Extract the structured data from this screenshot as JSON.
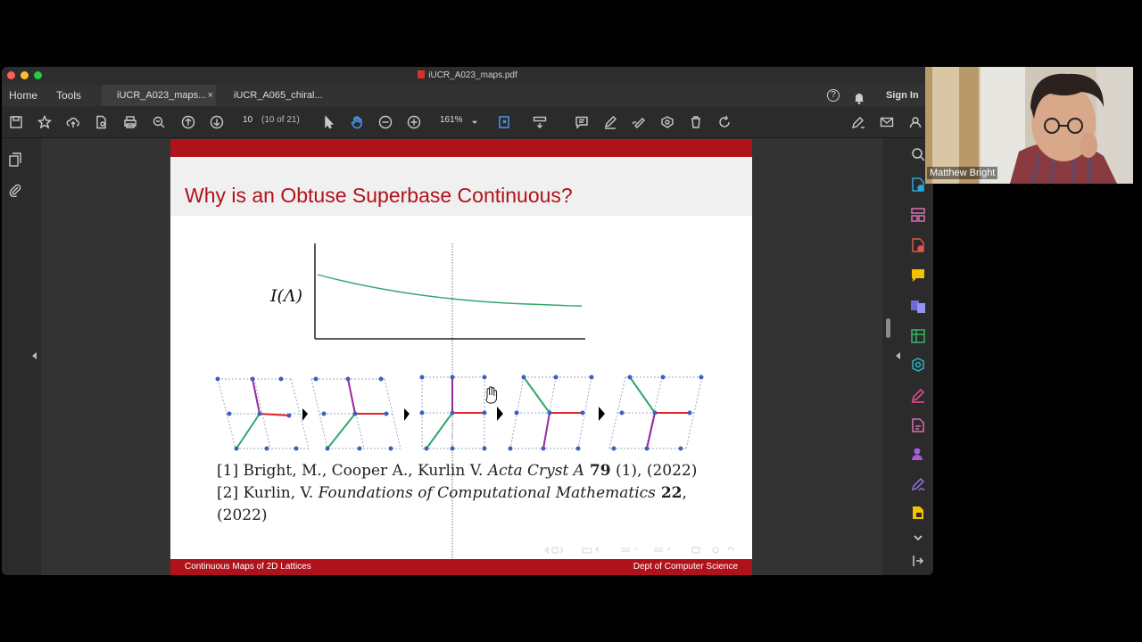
{
  "window": {
    "title": "iUCR_A023_maps.pdf"
  },
  "tabs": {
    "home": "Home",
    "tools": "Tools",
    "tab1": "iUCR_A023_maps...",
    "tab2": "iUCR_A065_chiral...",
    "sign_in": "Sign In",
    "close": "×"
  },
  "toolbar": {
    "page": "10",
    "page_of": "(10 of 21)",
    "zoom": "161%"
  },
  "slide": {
    "title": "Why is an Obtuse Superbase Continuous?",
    "ylabel": "I(Λ)",
    "ref1_pre": "[1] Bright, M., Cooper A., Kurlin V. ",
    "ref1_journal": "Acta Cryst A",
    "ref1_vol": " 79",
    "ref1_post": " (1), (2022)",
    "ref2_pre": "[2] Kurlin, V. ",
    "ref2_journal": "Foundations of Computational Mathematics",
    "ref2_vol": " 22",
    "ref2_post": ",",
    "ref2_line2": "(2022)",
    "footer_left": "Continuous Maps of 2D Lattices",
    "footer_right": "Dept of Computer Science"
  },
  "participant": {
    "name": "Matthew Bright"
  },
  "colors": {
    "accent": "#b0121b",
    "curve": "#2ea86b"
  }
}
